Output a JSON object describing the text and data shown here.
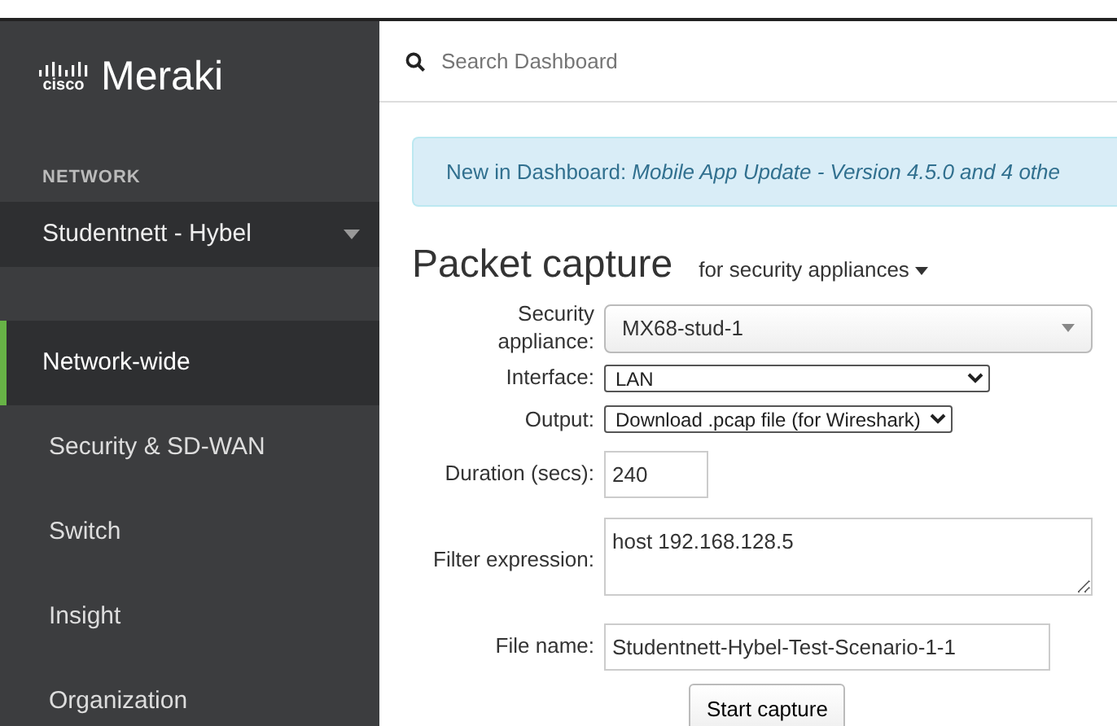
{
  "logo": {
    "brand": "cisco",
    "product": "Meraki"
  },
  "sidebar": {
    "section_label": "NETWORK",
    "network": "Studentnett - Hybel",
    "items": [
      {
        "label": "Network-wide",
        "selected": true
      },
      {
        "label": "Security & SD-WAN",
        "selected": false
      },
      {
        "label": "Switch",
        "selected": false
      },
      {
        "label": "Insight",
        "selected": false
      },
      {
        "label": "Organization",
        "selected": false
      }
    ]
  },
  "search": {
    "placeholder": "Search Dashboard"
  },
  "notice": "New in Dashboard: *Mobile App Update - Version 4.5.0 and 4 othe*",
  "page": {
    "title": "Packet capture",
    "scope": "for security appliances"
  },
  "form": [
    {
      "kind": "styled-select",
      "label": "Security appliance:",
      "value": "MX68-stud-1"
    },
    {
      "kind": "select",
      "label": "Interface:",
      "value": "LAN"
    },
    {
      "kind": "select",
      "label": "Output:",
      "value": "Download .pcap file (for Wireshark)"
    },
    {
      "kind": "input",
      "label": "Duration (secs):",
      "value": "240"
    },
    {
      "kind": "textarea",
      "label": "Filter expression:",
      "value": "host 192.168.128.5"
    },
    {
      "kind": "input",
      "label": "File name:",
      "value": "Studentnett-Hybel-Test-Scenario-1-1"
    }
  ],
  "submit": "Start capture"
}
